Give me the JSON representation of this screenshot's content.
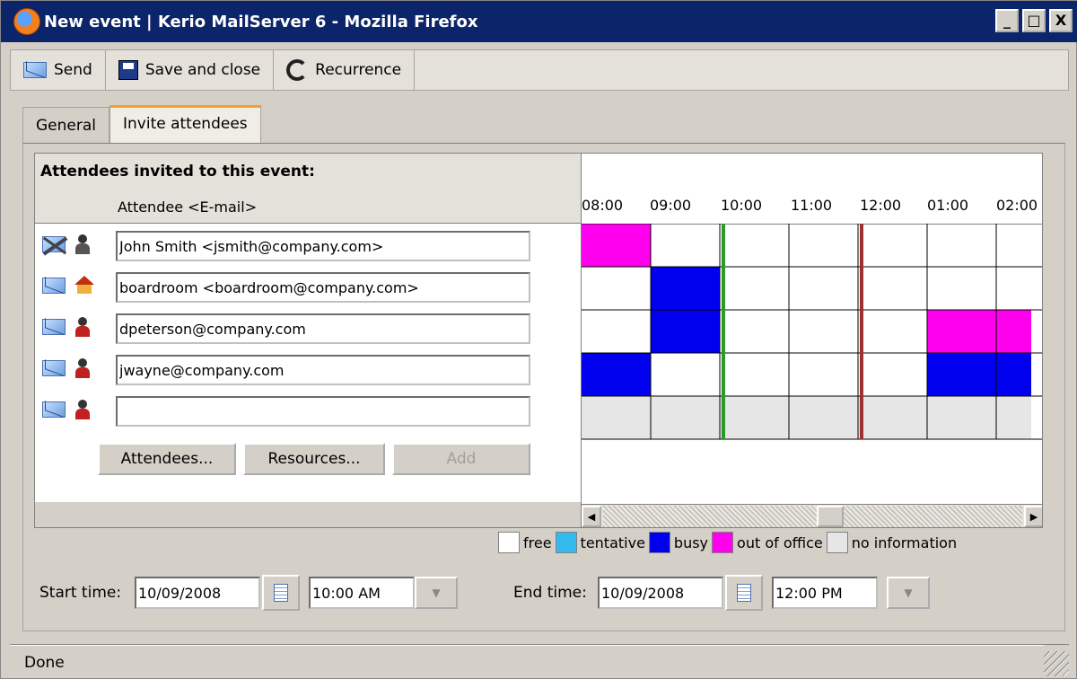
{
  "window": {
    "title": "New event | Kerio MailServer 6 - Mozilla Firefox",
    "controls": [
      "_",
      "□",
      "X"
    ]
  },
  "toolbar": {
    "send_label": "Send",
    "save_label": "Save and close",
    "recurrence_label": "Recurrence"
  },
  "tabs": [
    {
      "label": "General",
      "active": false
    },
    {
      "label": "Invite attendees",
      "active": true
    }
  ],
  "attendees": {
    "heading": "Attendees invited to this event:",
    "column_header": "Attendee <E-mail>",
    "rows": [
      {
        "value": "John Smith <jsmith@company.com>",
        "mail_icon": "crossed-mail-icon",
        "type_icon": "person-icon"
      },
      {
        "value": "boardroom <boardroom@company.com>",
        "mail_icon": "mail-icon",
        "type_icon": "house-icon"
      },
      {
        "value": "dpeterson@company.com",
        "mail_icon": "mail-icon",
        "type_icon": "person-icon"
      },
      {
        "value": "jwayne@company.com",
        "mail_icon": "mail-icon",
        "type_icon": "person-icon"
      },
      {
        "value": "",
        "mail_icon": "mail-icon",
        "type_icon": "person-icon"
      }
    ],
    "buttons": {
      "attendees": "Attendees...",
      "resources": "Resources...",
      "add": "Add"
    }
  },
  "schedule": {
    "hours": [
      "08:00",
      "09:00",
      "10:00",
      "11:00",
      "12:00",
      "01:00",
      "02:00"
    ],
    "event_start_marker": "10:00",
    "event_end_marker": "12:00",
    "marker_colors": {
      "start": "#2a9a2a",
      "end": "#a03030"
    },
    "status_colors": {
      "free": "#ffffff",
      "tentative": "#33bbf0",
      "busy": "#0000ee",
      "oof": "#ff00ee",
      "noinfo": "#e6e6e6"
    },
    "rows": [
      [
        "oof",
        "free",
        "free",
        "free",
        "free",
        "free",
        "free"
      ],
      [
        "free",
        "busy",
        "free",
        "free",
        "free",
        "free",
        "free"
      ],
      [
        "free",
        "busy",
        "free",
        "free",
        "free",
        "oof",
        "oof"
      ],
      [
        "busy",
        "free",
        "free",
        "free",
        "free",
        "busy",
        "busy"
      ],
      [
        "noinfo",
        "noinfo",
        "noinfo",
        "noinfo",
        "noinfo",
        "noinfo",
        "noinfo"
      ]
    ]
  },
  "legend": {
    "free": "free",
    "tentative": "tentative",
    "busy": "busy",
    "oof": "out of office",
    "noinfo": "no information"
  },
  "times": {
    "start_label": "Start time:",
    "start_date": "10/09/2008",
    "start_time": "10:00 AM",
    "end_label": "End time:",
    "end_date": "10/09/2008",
    "end_time": "12:00 PM"
  },
  "status": {
    "text": "Done"
  }
}
